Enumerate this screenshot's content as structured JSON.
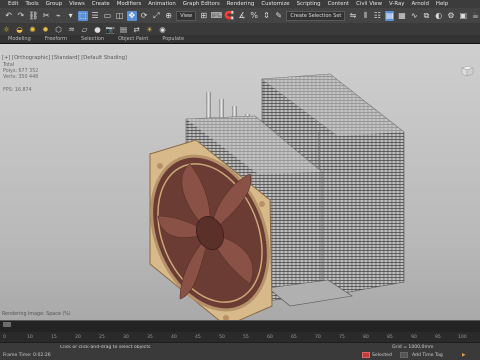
{
  "menu": [
    "Edit",
    "Tools",
    "Group",
    "Views",
    "Create",
    "Modifiers",
    "Animation",
    "Graph Editors",
    "Rendering",
    "Customize",
    "Scripting",
    "Content",
    "Civil View",
    "V-Ray",
    "Arnold",
    "Help"
  ],
  "toolbar": {
    "view_select": "View",
    "named_selection": "Create Selection Set",
    "snap_value": "3"
  },
  "ribbon": [
    "Modeling",
    "Freeform",
    "Selection",
    "Object Paint",
    "Populate"
  ],
  "viewport": {
    "label": "[+] [Orthographic] [Standard] [Default Shading]",
    "stats": [
      "Total",
      "Polys: 677 352",
      "Verts: 350 448"
    ],
    "fps": "FPS: 16.874",
    "status": "Rendering Image: Space (%)"
  },
  "timeline": {
    "ticks": [
      "0",
      "10",
      "15",
      "20",
      "25",
      "30",
      "35",
      "40",
      "45",
      "50",
      "55",
      "60",
      "65",
      "70",
      "75",
      "80",
      "85",
      "90",
      "95",
      "100"
    ]
  },
  "statusbar": {
    "left": "Click or click-and-drag to select objects",
    "time_label": "Frame Time: 0:02:26",
    "grid": "Grid = 1000,0mm",
    "autokey": "Auto Key",
    "selected": "Selected",
    "setkey": "Set Key",
    "keyfilters": "Key Filters...",
    "addtimetag": "Add Time Tag"
  },
  "colors": {
    "accent": "#5b8fd6",
    "fan": "#7a4a40",
    "frame": "#d8b98a",
    "fins": "#9a9a9a"
  }
}
